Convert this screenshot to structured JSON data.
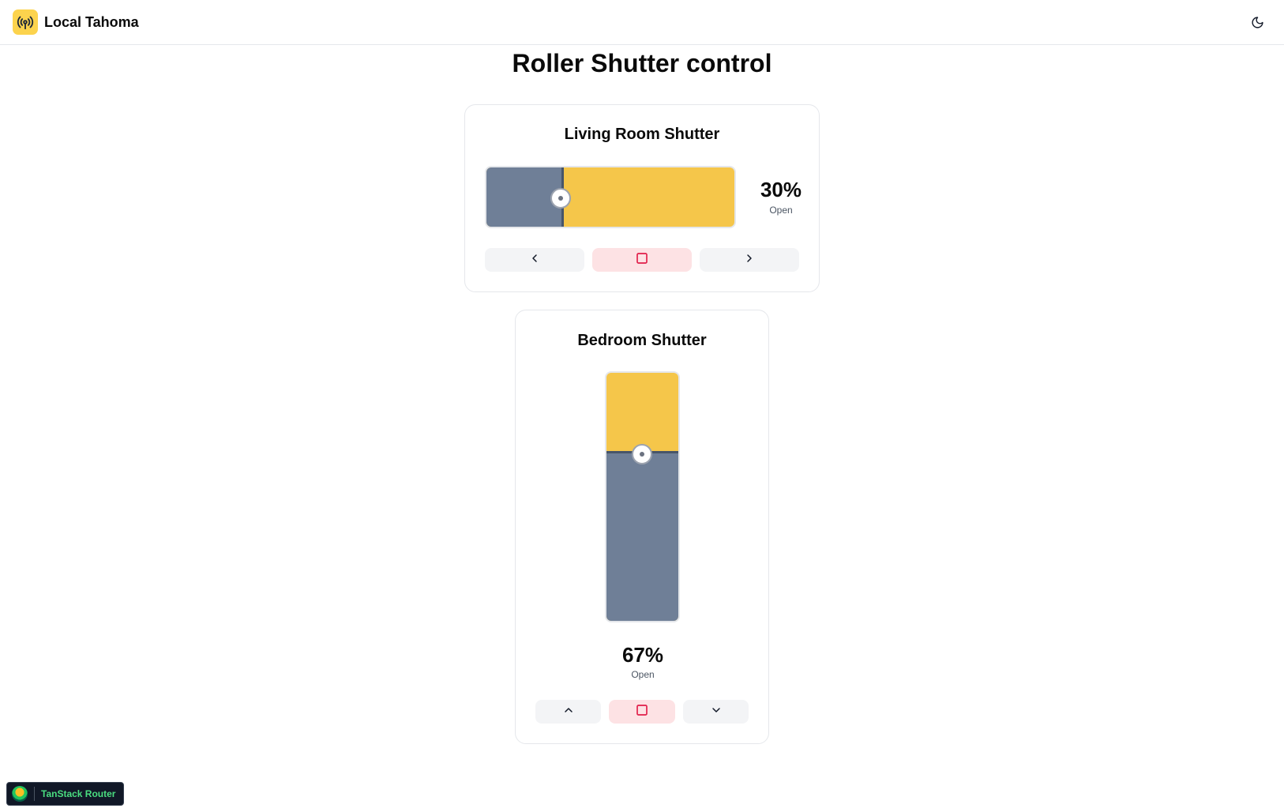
{
  "header": {
    "app_title": "Local Tahoma",
    "logo_icon": "broadcast-antenna-icon",
    "theme_toggle_icon": "moon-icon"
  },
  "page": {
    "title": "Roller Shutter control"
  },
  "shutters": [
    {
      "name": "Living Room Shutter",
      "orientation": "horizontal",
      "position_percent": "30%",
      "position_fraction": 0.3,
      "state_label": "Open",
      "buttons": [
        "chevron-left-icon",
        "stop-icon",
        "chevron-right-icon"
      ]
    },
    {
      "name": "Bedroom Shutter",
      "orientation": "vertical",
      "position_percent": "67%",
      "position_fraction": 0.67,
      "state_label": "Open",
      "buttons": [
        "chevron-up-icon",
        "stop-icon",
        "chevron-down-icon"
      ]
    }
  ],
  "devtools": {
    "label": "TanStack Router"
  },
  "colors": {
    "accent_yellow": "#f5c64a",
    "shade_slate": "#6f7f97",
    "stop_red": "#e11d48"
  }
}
